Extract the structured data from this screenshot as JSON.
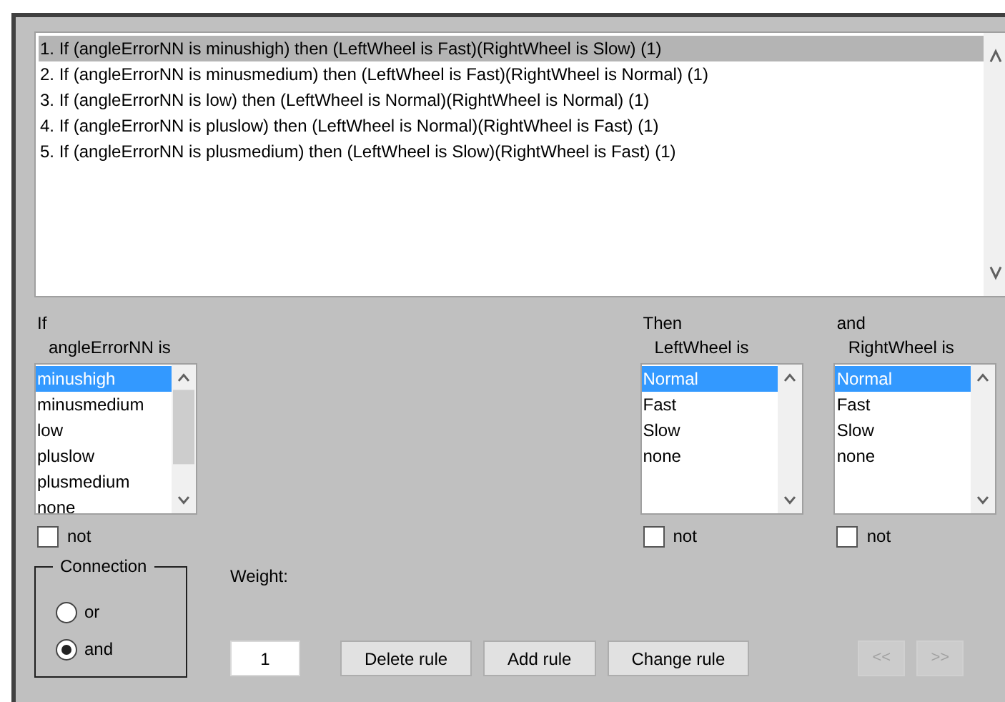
{
  "rules": {
    "items": [
      {
        "text": "1. If (angleErrorNN is minushigh) then (LeftWheel is Fast)(RightWheel is Slow) (1)",
        "selected": true
      },
      {
        "text": "2. If (angleErrorNN is minusmedium) then (LeftWheel is Fast)(RightWheel is Normal) (1)",
        "selected": false
      },
      {
        "text": "3. If (angleErrorNN is low) then (LeftWheel is Normal)(RightWheel is Normal) (1)",
        "selected": false
      },
      {
        "text": "4. If (angleErrorNN is pluslow) then (LeftWheel is Normal)(RightWheel is Fast) (1)",
        "selected": false
      },
      {
        "text": "5. If (angleErrorNN is plusmedium) then (LeftWheel is Slow)(RightWheel is Fast) (1)",
        "selected": false
      }
    ]
  },
  "columns": [
    {
      "heading": "If",
      "label": "angleErrorNN is",
      "options": [
        {
          "label": "minushigh",
          "selected": true
        },
        {
          "label": "minusmedium",
          "selected": false
        },
        {
          "label": "low",
          "selected": false
        },
        {
          "label": "pluslow",
          "selected": false
        },
        {
          "label": "plusmedium",
          "selected": false
        },
        {
          "label": "none",
          "selected": false
        }
      ],
      "not": {
        "label": "not",
        "checked": false
      }
    },
    {
      "heading": "Then",
      "label": "LeftWheel is",
      "options": [
        {
          "label": "Normal",
          "selected": true
        },
        {
          "label": "Fast",
          "selected": false
        },
        {
          "label": "Slow",
          "selected": false
        },
        {
          "label": "none",
          "selected": false
        }
      ],
      "not": {
        "label": "not",
        "checked": false
      }
    },
    {
      "heading": "and",
      "label": "RightWheel is",
      "options": [
        {
          "label": "Normal",
          "selected": true
        },
        {
          "label": "Fast",
          "selected": false
        },
        {
          "label": "Slow",
          "selected": false
        },
        {
          "label": "none",
          "selected": false
        }
      ],
      "not": {
        "label": "not",
        "checked": false
      }
    }
  ],
  "connection": {
    "title": "Connection",
    "options": [
      {
        "label": "or",
        "selected": false
      },
      {
        "label": "and",
        "selected": true
      }
    ]
  },
  "weight": {
    "label": "Weight:",
    "value": "1"
  },
  "buttons": [
    {
      "label": "Delete rule",
      "disabled": false
    },
    {
      "label": "Add rule",
      "disabled": false
    },
    {
      "label": "Change rule",
      "disabled": false
    }
  ],
  "nav_buttons": [
    {
      "label": "<<",
      "disabled": true
    },
    {
      "label": ">>",
      "disabled": true
    }
  ]
}
